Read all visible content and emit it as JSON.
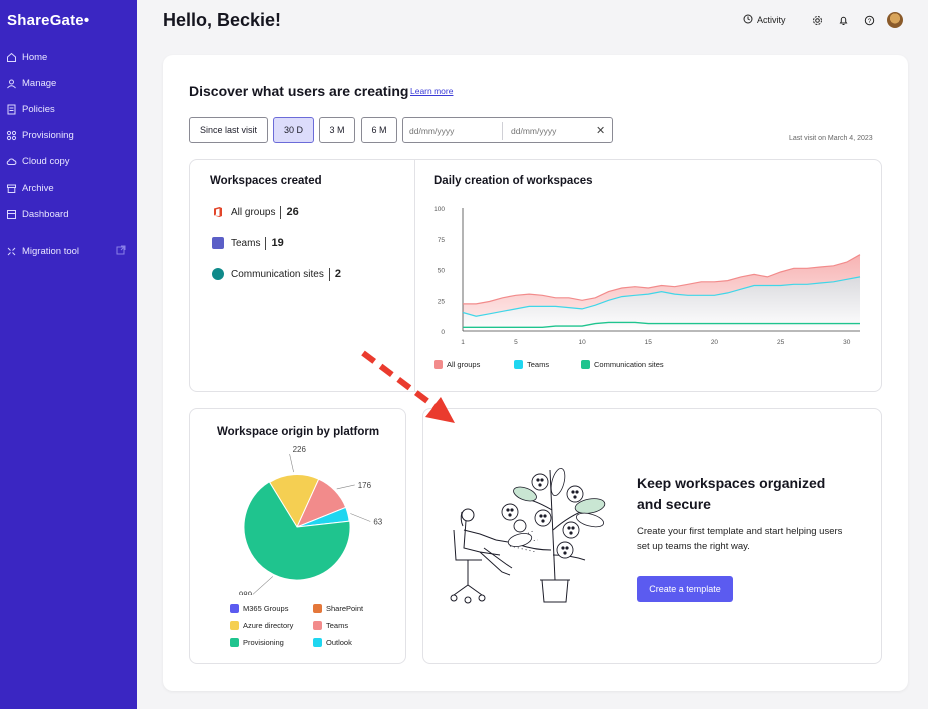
{
  "sidebar": {
    "logo": "ShareGate•",
    "items": [
      {
        "label": "Home",
        "icon": "home-icon"
      },
      {
        "label": "Manage",
        "icon": "manage-icon"
      },
      {
        "label": "Policies",
        "icon": "policies-icon"
      },
      {
        "label": "Provisioning",
        "icon": "provisioning-icon"
      },
      {
        "label": "Cloud copy",
        "icon": "cloud-icon"
      },
      {
        "label": "Archive",
        "icon": "archive-icon"
      },
      {
        "label": "Dashboard",
        "icon": "dashboard-icon"
      },
      {
        "label": "Migration tool",
        "icon": "migration-icon"
      }
    ]
  },
  "header": {
    "greeting": "Hello, Beckie!",
    "activity": "Activity"
  },
  "discover": {
    "title": "Discover what users are creating",
    "learn_more": "Learn more",
    "filters": [
      "Since last visit",
      "30 D",
      "3 M",
      "6 M"
    ],
    "active_filter": "30 D",
    "date_from_placeholder": "dd/mm/yyyy",
    "date_to_placeholder": "dd/mm/yyyy",
    "last_visit": "Last visit on March 4, 2023"
  },
  "workspaces_created": {
    "title": "Workspaces created",
    "rows": [
      {
        "label": "All groups",
        "value": "26"
      },
      {
        "label": "Teams",
        "value": "19"
      },
      {
        "label": "Communication sites",
        "value": "2"
      }
    ]
  },
  "daily_creation": {
    "title": "Daily creation of workspaces",
    "legend": [
      "All groups",
      "Teams",
      "Communication sites"
    ],
    "colors": {
      "all_groups": "#f28b8b",
      "teams": "#3fd6e8",
      "communication_sites": "#1fc48e"
    }
  },
  "origin": {
    "title": "Workspace origin by platform",
    "legend": [
      {
        "label": "M365 Groups",
        "color": "#5b5bf0"
      },
      {
        "label": "SharePoint",
        "color": "#e4773a"
      },
      {
        "label": "Azure directory",
        "color": "#f5cf52"
      },
      {
        "label": "Teams",
        "color": "#f28b8b"
      },
      {
        "label": "Provisioning",
        "color": "#1fc48e"
      },
      {
        "label": "Outlook",
        "color": "#1fd6f0"
      }
    ]
  },
  "promo": {
    "title": "Keep workspaces organized and secure",
    "text": "Create your first template and start helping users set up teams the right way.",
    "button": "Create a template"
  },
  "chart_data": [
    {
      "type": "area",
      "title": "Daily creation of workspaces",
      "x": [
        1,
        2,
        3,
        4,
        5,
        6,
        7,
        8,
        9,
        10,
        11,
        12,
        13,
        14,
        15,
        16,
        17,
        18,
        19,
        20,
        21,
        22,
        23,
        24,
        25,
        26,
        27,
        28,
        29,
        30,
        31
      ],
      "xticks": [
        1,
        5,
        10,
        15,
        20,
        25,
        30
      ],
      "yticks": [
        0,
        25,
        50,
        75,
        100
      ],
      "ylim": [
        0,
        100
      ],
      "series": [
        {
          "name": "All groups",
          "color": "#f28b8b",
          "values": [
            22,
            22,
            24,
            27,
            29,
            30,
            29,
            27,
            27,
            25,
            27,
            32,
            35,
            36,
            35,
            37,
            36,
            38,
            40,
            40,
            41,
            44,
            46,
            44,
            48,
            51,
            51,
            52,
            53,
            56,
            62
          ]
        },
        {
          "name": "Teams",
          "color": "#3fd6e8",
          "values": [
            15,
            12,
            14,
            16,
            18,
            20,
            20,
            20,
            19,
            18,
            21,
            25,
            28,
            29,
            30,
            32,
            30,
            29,
            29,
            29,
            31,
            34,
            37,
            37,
            37,
            38,
            38,
            39,
            40,
            42,
            44
          ]
        },
        {
          "name": "Communication sites",
          "color": "#1fc48e",
          "values": [
            3,
            3,
            3,
            3,
            3,
            3,
            3,
            4,
            4,
            4,
            6,
            7,
            7,
            7,
            6,
            6,
            6,
            6,
            6,
            6,
            6,
            6,
            6,
            6,
            6,
            6,
            6,
            6,
            6,
            6,
            6
          ]
        }
      ]
    },
    {
      "type": "pie",
      "title": "Workspace origin by platform",
      "categories": [
        "Azure directory",
        "Teams",
        "Outlook",
        "Provisioning"
      ],
      "values": [
        226,
        176,
        63,
        989
      ],
      "colors": [
        "#f5cf52",
        "#f28b8b",
        "#1fd6f0",
        "#1fc48e"
      ]
    }
  ]
}
